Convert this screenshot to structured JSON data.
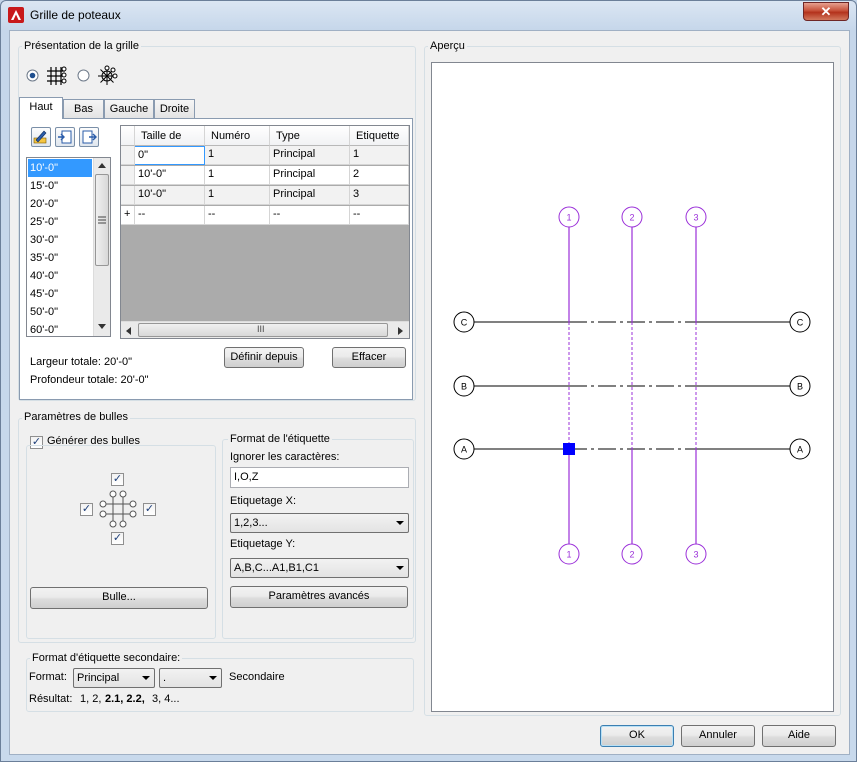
{
  "window": {
    "title": "Grille de poteaux",
    "close_label": "✕"
  },
  "layout_group": {
    "title": "Présentation de la grille",
    "radio_options": [
      {
        "name": "rectangular-grid",
        "icon": "rectangular-grid-icon",
        "selected": true
      },
      {
        "name": "radial-grid",
        "icon": "radial-grid-icon",
        "selected": false
      }
    ],
    "tabs": [
      {
        "label": "Haut",
        "active": true
      },
      {
        "label": "Bas",
        "active": false
      },
      {
        "label": "Gauche",
        "active": false
      },
      {
        "label": "Droite",
        "active": false
      }
    ],
    "toolbar_icons": [
      "edit-pencil-icon",
      "insert-icon",
      "export-icon"
    ],
    "size_list": {
      "items": [
        "10'-0\"",
        "15'-0\"",
        "20'-0\"",
        "25'-0\"",
        "30'-0\"",
        "35'-0\"",
        "40'-0\"",
        "45'-0\"",
        "50'-0\"",
        "60'-0\""
      ],
      "selected_index": 0
    },
    "table": {
      "columns": [
        "Taille de",
        "Numéro",
        "Type",
        "Etiquette"
      ],
      "rows": [
        [
          "0\"",
          "1",
          "Principal",
          "1"
        ],
        [
          "10'-0\"",
          "1",
          "Principal",
          "2"
        ],
        [
          "10'-0\"",
          "1",
          "Principal",
          "3"
        ]
      ],
      "new_row": {
        "marker": "+",
        "cells": [
          "--",
          "--",
          "--",
          "--"
        ]
      },
      "hscroll_grip": "III"
    },
    "buttons": {
      "define_from": "Définir depuis",
      "clear": "Effacer"
    },
    "total_width": "Largeur totale: 20'-0\"",
    "total_depth": "Profondeur totale: 20'-0\""
  },
  "bubble_group": {
    "title": "Paramètres de bulles",
    "generate_bubbles": {
      "label": "Générer des bulles",
      "checked": true
    },
    "positions": {
      "top": true,
      "left": true,
      "right": true,
      "bottom": true
    },
    "bubble_button": "Bulle...",
    "label_format": {
      "title": "Format de l'étiquette",
      "ignore_label": "Ignorer les caractères:",
      "ignore_value": "I,O,Z",
      "x_label": "Etiquetage X:",
      "x_value": "1,2,3...",
      "y_label": "Etiquetage Y:",
      "y_value": "A,B,C...A1,B1,C1",
      "advanced_button": "Paramètres avancés"
    }
  },
  "secondary_group": {
    "title": "Format d'étiquette secondaire:",
    "format_label": "Format:",
    "format_value": "Principal",
    "separator_value": ".",
    "secondary_label": "Secondaire",
    "result_label": "Résultat:",
    "result_plain": "1, 2,",
    "result_bold": "2.1, 2.2,",
    "result_tail": "3, 4..."
  },
  "preview": {
    "title": "Aperçu",
    "column_labels": [
      "1",
      "2",
      "3"
    ],
    "row_labels": [
      "C",
      "B",
      "A"
    ],
    "colors": {
      "column_lines": "#9b30d9",
      "row_lines": "#000000",
      "marker": "#0000ff"
    }
  },
  "footer": {
    "ok": "OK",
    "cancel": "Annuler",
    "help": "Aide"
  }
}
